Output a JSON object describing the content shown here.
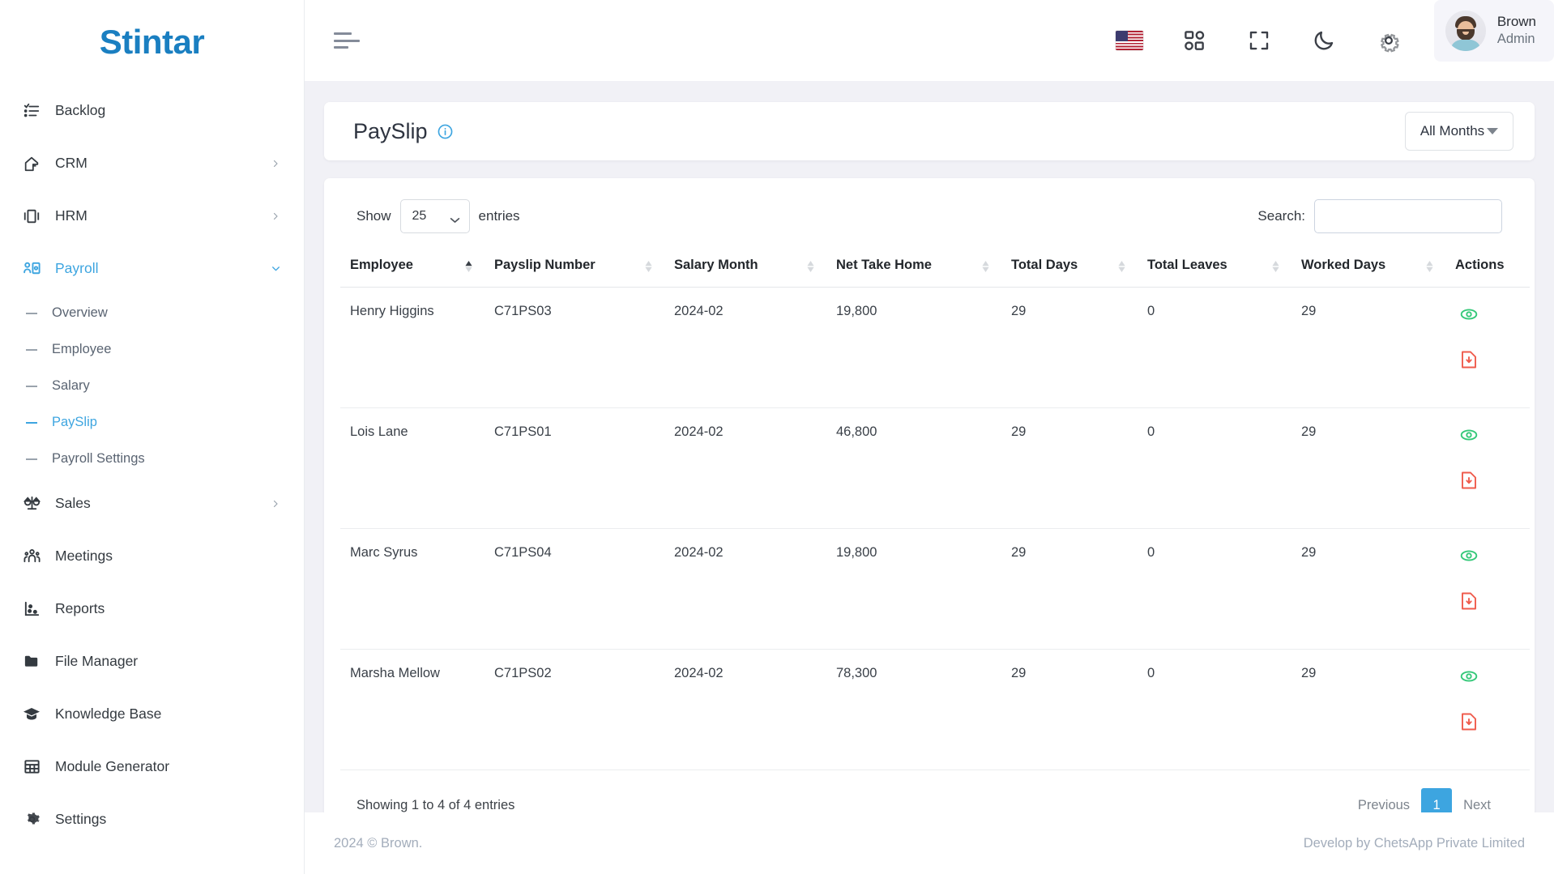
{
  "brand": {
    "name": "Stintar",
    "accent": "#1a7fc1"
  },
  "sidebar": {
    "items": [
      {
        "label": "Backlog",
        "icon": "backlog-icon",
        "has_chevron": false,
        "active": false
      },
      {
        "label": "CRM",
        "icon": "crm-icon",
        "has_chevron": true,
        "active": false
      },
      {
        "label": "HRM",
        "icon": "hrm-icon",
        "has_chevron": true,
        "active": false
      },
      {
        "label": "Payroll",
        "icon": "payroll-icon",
        "has_chevron": true,
        "active": true
      },
      {
        "label": "Sales",
        "icon": "sales-icon",
        "has_chevron": true,
        "active": false
      },
      {
        "label": "Meetings",
        "icon": "meetings-icon",
        "has_chevron": false,
        "active": false
      },
      {
        "label": "Reports",
        "icon": "reports-icon",
        "has_chevron": false,
        "active": false
      },
      {
        "label": "File Manager",
        "icon": "folder-icon",
        "has_chevron": false,
        "active": false
      },
      {
        "label": "Knowledge Base",
        "icon": "graduation-cap-icon",
        "has_chevron": false,
        "active": false
      },
      {
        "label": "Module Generator",
        "icon": "grid-table-icon",
        "has_chevron": false,
        "active": false
      },
      {
        "label": "Settings",
        "icon": "gear-icon",
        "has_chevron": false,
        "active": false
      }
    ],
    "payroll_submenu": [
      {
        "label": "Overview",
        "active": false
      },
      {
        "label": "Employee",
        "active": false
      },
      {
        "label": "Salary",
        "active": false
      },
      {
        "label": "PaySlip",
        "active": true
      },
      {
        "label": "Payroll Settings",
        "active": false
      }
    ],
    "active_accent": "#3da5e0"
  },
  "topbar": {
    "menu_toggle": "hamburger-icon",
    "icons": [
      "flag-us-icon",
      "apps-grid-icon",
      "fullscreen-icon",
      "dark-mode-moon-icon",
      "gear-icon"
    ],
    "profile": {
      "name": "Brown",
      "role": "Admin"
    }
  },
  "page": {
    "title": "PaySlip",
    "info_icon": "info-circle-icon",
    "month_filter": {
      "value": "All Months"
    }
  },
  "table": {
    "show_label": "Show",
    "entries_label": "entries",
    "page_size": "25",
    "search_label": "Search:",
    "search_value": "",
    "search_placeholder": "",
    "columns": [
      {
        "label": "Employee",
        "sortable": true,
        "sort": "asc"
      },
      {
        "label": "Payslip Number",
        "sortable": true,
        "sort": "none"
      },
      {
        "label": "Salary Month",
        "sortable": true,
        "sort": "none"
      },
      {
        "label": "Net Take Home",
        "sortable": true,
        "sort": "none"
      },
      {
        "label": "Total Days",
        "sortable": true,
        "sort": "none"
      },
      {
        "label": "Total Leaves",
        "sortable": true,
        "sort": "none"
      },
      {
        "label": "Worked Days",
        "sortable": true,
        "sort": "none"
      },
      {
        "label": "Actions",
        "sortable": false,
        "sort": "none"
      }
    ],
    "rows": [
      {
        "employee": "Henry Higgins",
        "payslip_number": "C71PS03",
        "salary_month": "2024-02",
        "net_take_home": "19,800",
        "total_days": "29",
        "total_leaves": "0",
        "worked_days": "29"
      },
      {
        "employee": "Lois Lane",
        "payslip_number": "C71PS01",
        "salary_month": "2024-02",
        "net_take_home": "46,800",
        "total_days": "29",
        "total_leaves": "0",
        "worked_days": "29"
      },
      {
        "employee": "Marc Syrus",
        "payslip_number": "C71PS04",
        "salary_month": "2024-02",
        "net_take_home": "19,800",
        "total_days": "29",
        "total_leaves": "0",
        "worked_days": "29"
      },
      {
        "employee": "Marsha Mellow",
        "payslip_number": "C71PS02",
        "salary_month": "2024-02",
        "net_take_home": "78,300",
        "total_days": "29",
        "total_leaves": "0",
        "worked_days": "29"
      }
    ],
    "row_actions": [
      {
        "name": "view-payslip-icon",
        "icon": "eye-icon",
        "color": "#35c879"
      },
      {
        "name": "download-pdf-icon",
        "icon": "file-download-icon",
        "color": "#ef5b4c"
      }
    ],
    "info_text": "Showing 1 to 4 of 4 entries",
    "pagination": {
      "previous_label": "Previous",
      "next_label": "Next",
      "pages": [
        "1"
      ],
      "current_page": "1",
      "active_color": "#3da5e0"
    }
  },
  "footer": {
    "left": "2024 © Brown.",
    "right": "Develop by ChetsApp Private Limited"
  }
}
